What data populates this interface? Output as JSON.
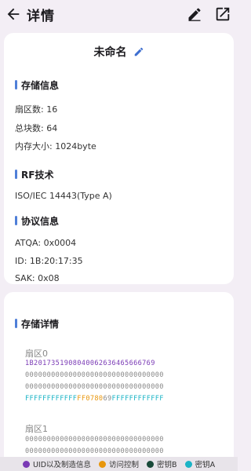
{
  "header": {
    "title": "详情",
    "back_icon": "arrow-left-icon",
    "edit_icon": "pencil-icon",
    "share_icon": "open-external-icon"
  },
  "card": {
    "name": "未命名",
    "storage_title": "存储信息",
    "sectors": "扇区数: 16",
    "blocks": "总块数: 64",
    "memory": "内存大小: 1024byte",
    "rf_title": "RF技术",
    "rf_value": "ISO/IEC 14443(Type A)",
    "protocol_title": "协议信息",
    "atqa": "ATQA: 0x0004",
    "id": "ID: 1B:20:17:35",
    "sak": "SAK: 0x08"
  },
  "details": {
    "title": "存储详情",
    "sectors": [
      {
        "label": "扇区0",
        "rows": [
          "1B2017351908040062636465666769",
          "00000000000000000000000000000000",
          "00000000000000000000000000000000"
        ],
        "trailer": {
          "key_a": "FFFFFFFFFFFF",
          "access": "FF0780",
          "gpb": "69",
          "key_b": "FFFFFFFFFFFF"
        }
      },
      {
        "label": "扇区1",
        "rows": [
          "00000000000000000000000000000000",
          "00000000000000000000000000000000"
        ]
      }
    ]
  },
  "legend": [
    {
      "label": "UID以及制造信息",
      "color": "#7a3ab5"
    },
    {
      "label": "访问控制",
      "color": "#e8960c"
    },
    {
      "label": "密钥B",
      "color": "#1a4a3a"
    },
    {
      "label": "密钥A",
      "color": "#1bb4c6"
    }
  ]
}
